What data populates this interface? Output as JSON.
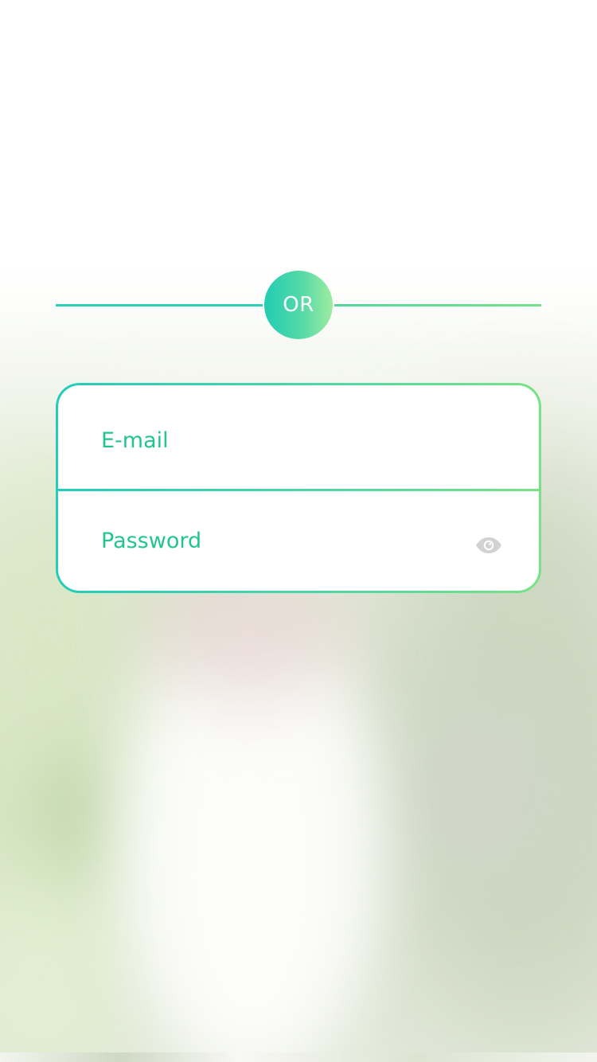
{
  "divider": {
    "label": "OR"
  },
  "form": {
    "email": {
      "placeholder": "E-mail",
      "value": ""
    },
    "password": {
      "placeholder": "Password",
      "value": "",
      "toggle_icon": "eye-icon"
    }
  },
  "colors": {
    "accent_start": "#25cbbb",
    "accent_end": "#79e286",
    "label_text": "#22c58f",
    "icon_gray": "#d2d2d2"
  }
}
